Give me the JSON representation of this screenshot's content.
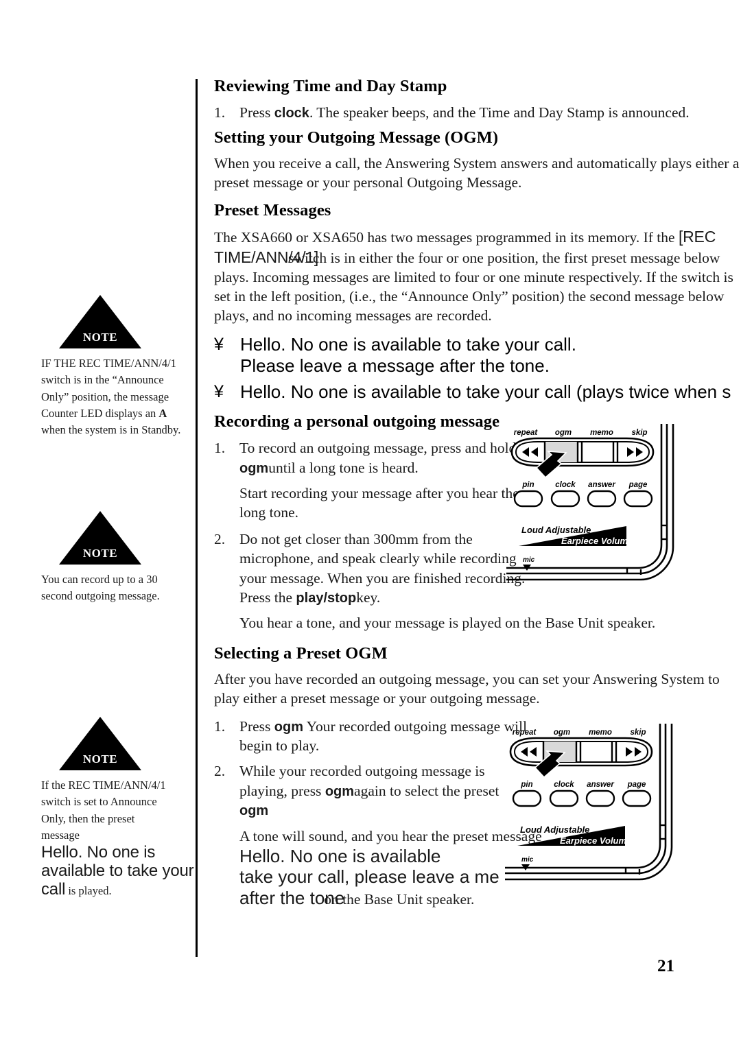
{
  "page": {
    "number": "21"
  },
  "sidebar": {
    "notes": [
      {
        "label": "NOTE",
        "text_parts": {
          "before": "IF THE REC TIME/ANN/4/1 switch is in the “Announce Only” position, the message Counter LED displays an ",
          "emphasis": "A",
          "after": " when the system is in Standby."
        }
      },
      {
        "label": "NOTE",
        "text": "You can record up to a 30 second outgoing message."
      },
      {
        "label": "NOTE",
        "text_parts": {
          "line1": "If the REC TIME/ANN/4/1",
          "line2": "switch is set to Announce",
          "line3": "Only, then the preset",
          "line4_label": "message",
          "quote_line1": "Hello. No one is",
          "quote_line2": "available to take your",
          "quote_line3": "call",
          "tail": "is played."
        }
      }
    ]
  },
  "main": {
    "section_review": {
      "heading": "Reviewing Time and Day Stamp",
      "step_1": {
        "num": "1.",
        "before": "Press ",
        "key": "clock",
        "after": ". The speaker beeps, and the Time and Day Stamp is announced."
      }
    },
    "section_ogm": {
      "heading": "Setting your Outgoing Message (OGM)",
      "paragraph": "When you receive a call, the Answering System answers and automatically plays either a preset message or your personal Outgoing Message."
    },
    "section_preset": {
      "heading": "Preset Messages",
      "para_before": "The XSA660 or XSA650 has two messages programmed in its memory. If the ",
      "switch_token": "[REC TIME/ANN/4/1]",
      "para_after": "switch is in either the four or one position, the first preset message below plays. Incoming messages are limited to four or one minute respectively. If the switch is set in the left position, (i.e., the “Announce Only” position) the second message below plays, and no incoming messages are recorded.",
      "bullets": [
        {
          "marker": "¥",
          "line1": "Hello. No one is available to take your call.",
          "line2": "Please leave a message after the tone."
        },
        {
          "marker": "¥",
          "line1": "Hello. No one is available to take your call (plays twice when s"
        }
      ]
    },
    "section_recording": {
      "heading": "Recording a personal outgoing message",
      "step_1": {
        "num": "1.",
        "before": "To record an outgoing message, press and hold ",
        "key": "ogm",
        "after": "until a long tone is heard."
      },
      "step_1_sub": "Start recording your message after you hear the long tone.",
      "step_2": {
        "num": "2.",
        "before": "Do not get closer than 300mm from the microphone, and speak clearly while recording your message. When you are finished recording. Press the ",
        "key": "play/stop",
        "after": "key."
      },
      "step_2_sub": "You hear a tone, and your message is played on the Base Unit speaker."
    },
    "section_selecting": {
      "heading": "Selecting a Preset OGM",
      "paragraph": "After you have recorded an outgoing message, you can set your Answering System to play either a preset message or your outgoing message.",
      "step_1": {
        "num": "1.",
        "before": " Press ",
        "key": "ogm",
        "after": " Your recorded outgoing message will begin to play."
      },
      "step_2": {
        "num": "2.",
        "before": "While your recorded outgoing message is playing, press ",
        "key": "ogm",
        "mid": "again to select the preset ",
        "key2": "ogm"
      },
      "step_2_sub": {
        "lead": "A tone will sound, and you hear the preset message",
        "quote_line1": "Hello. No one is available",
        "quote_line2": "take your call, please leave a me",
        "quote_line3": "after the tone",
        "tail": "on the Base Unit speaker."
      }
    }
  },
  "device_diagram": {
    "rocker_labels": [
      "repeat",
      "ogm",
      "memo",
      "skip"
    ],
    "button_labels": [
      "pin",
      "clock",
      "answer",
      "page"
    ],
    "volume_label_line1": "Loud Adjustable",
    "volume_label_line2": "Earpiece Volume",
    "mic_label": "mic",
    "highlight_color": "#d9d9d9",
    "arrow_target": "ogm"
  }
}
